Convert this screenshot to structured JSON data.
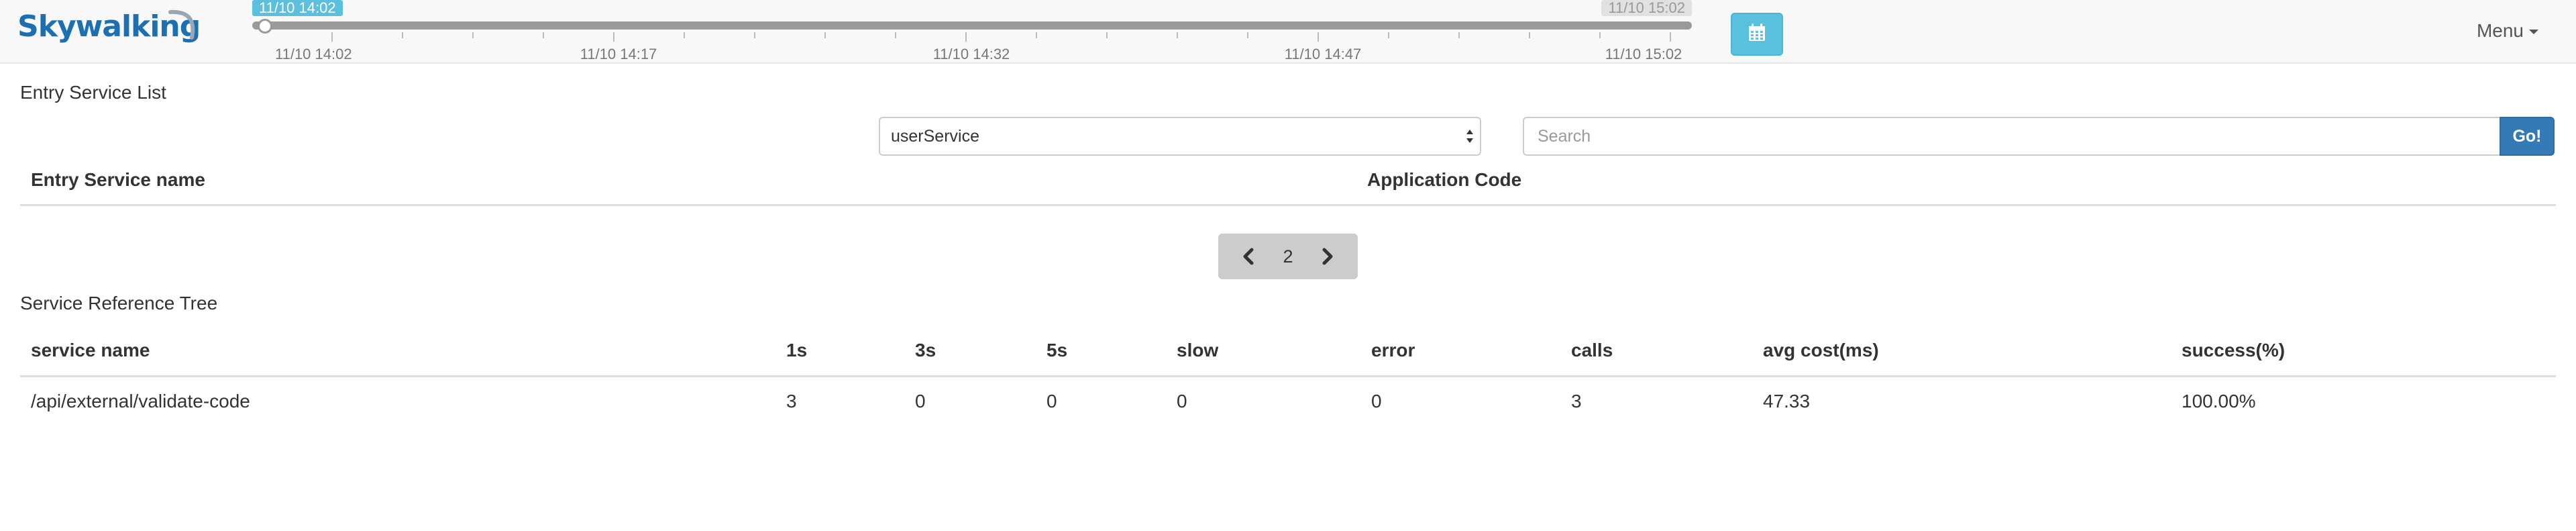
{
  "header": {
    "logo_text": "Skywalking",
    "timeline": {
      "start_tag": "11/10 14:02",
      "end_tag": "11/10 15:02",
      "labels": [
        "11/10 14:02",
        "11/10 14:17",
        "11/10 14:32",
        "11/10 14:47",
        "11/10 15:02"
      ]
    },
    "menu_label": "Menu"
  },
  "entry_service": {
    "title": "Entry Service List",
    "selected_application": "userService",
    "search_placeholder": "Search",
    "go_label": "Go!",
    "columns": [
      "Entry Service name",
      "Application Code"
    ],
    "rows": [],
    "pager": {
      "current_page": "2"
    }
  },
  "reference_tree": {
    "title": "Service Reference Tree",
    "columns": [
      "service name",
      "1s",
      "3s",
      "5s",
      "slow",
      "error",
      "calls",
      "avg cost(ms)",
      "success(%)"
    ],
    "rows": [
      [
        "/api/external/validate-code",
        "3",
        "0",
        "0",
        "0",
        "0",
        "3",
        "47.33",
        "100.00%"
      ]
    ]
  },
  "colors": {
    "brand": "#1c6fb1",
    "accent_info": "#5bc0de",
    "primary_button": "#337ab7",
    "header_bg": "#f8f8f8"
  },
  "icons": [
    "calendar-icon",
    "chevron-left-icon",
    "chevron-right-icon",
    "caret-down-icon",
    "select-arrows-icon"
  ]
}
